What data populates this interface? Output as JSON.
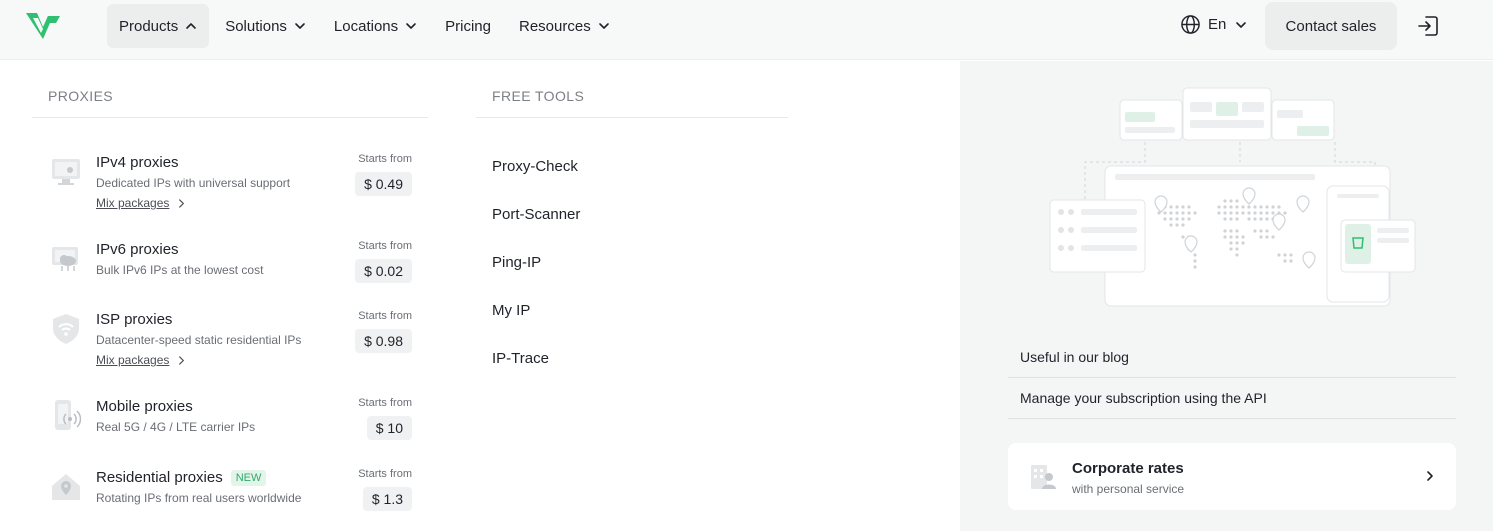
{
  "header": {
    "nav": [
      {
        "label": "Products",
        "active": true
      },
      {
        "label": "Solutions"
      },
      {
        "label": "Locations"
      },
      {
        "label": "Pricing"
      },
      {
        "label": "Resources"
      }
    ],
    "language": "En",
    "contact_label": "Contact sales"
  },
  "proxies": {
    "title": "PROXIES",
    "items": [
      {
        "name": "IPv4 proxies",
        "desc": "Dedicated IPs with universal support",
        "link": "Mix packages",
        "starts": "Starts from",
        "price": "$ 0.49",
        "icon": "monitor-icon"
      },
      {
        "name": "IPv6 proxies",
        "desc": "Bulk IPv6 IPs at the lowest cost",
        "starts": "Starts from",
        "price": "$ 0.02",
        "icon": "cloud-server-icon"
      },
      {
        "name": "ISP proxies",
        "desc": "Datacenter-speed static residential IPs",
        "link": "Mix packages",
        "starts": "Starts from",
        "price": "$ 0.98",
        "icon": "shield-wifi-icon"
      },
      {
        "name": "Mobile proxies",
        "desc": "Real 5G / 4G / LTE carrier IPs",
        "starts": "Starts from",
        "price": "$ 10",
        "icon": "mobile-signal-icon"
      },
      {
        "name": "Residential proxies",
        "badge": "NEW",
        "desc": "Rotating IPs from real users worldwide",
        "starts": "Starts from",
        "price": "$ 1.3",
        "icon": "house-pin-icon"
      }
    ]
  },
  "tools": {
    "title": "FREE TOOLS",
    "items": [
      "Proxy-Check",
      "Port-Scanner",
      "Ping-IP",
      "My IP",
      "IP-Trace"
    ]
  },
  "aside": {
    "links": [
      "Useful in our blog",
      "Manage your subscription using the API"
    ],
    "corporate": {
      "title": "Corporate rates",
      "subtitle": "with personal service"
    }
  },
  "colors": {
    "accent": "#2fbf71",
    "panel": "#f4f5f5",
    "text": "#1f2229"
  }
}
